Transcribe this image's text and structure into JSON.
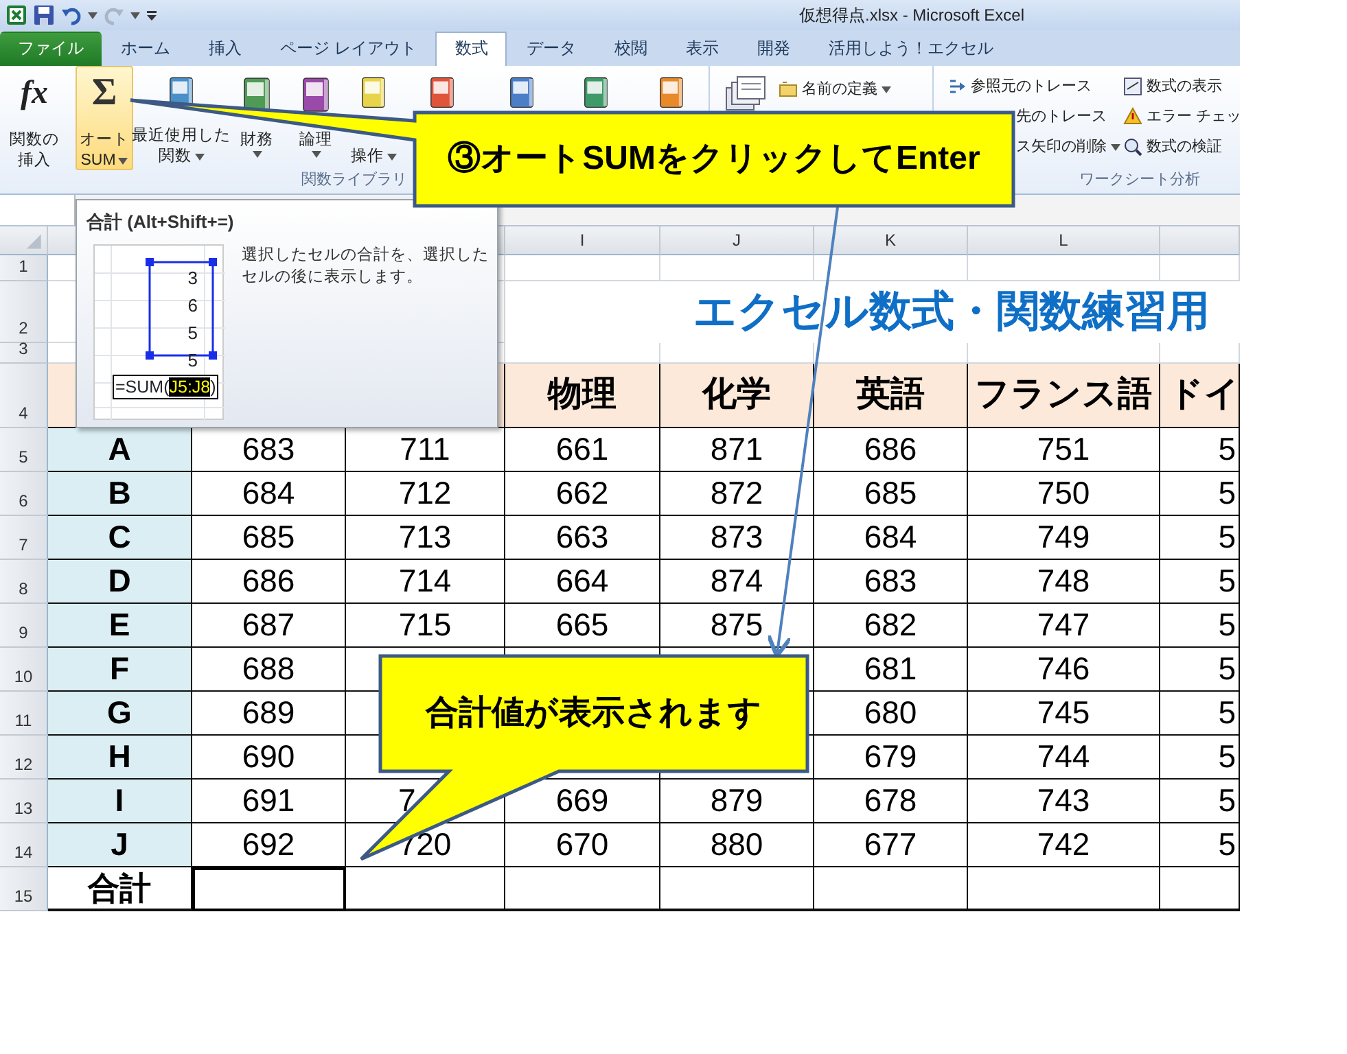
{
  "title_bar": {
    "title": "仮想得点.xlsx - Microsoft Excel"
  },
  "tabs": [
    {
      "label": "ファイル",
      "kind": "file",
      "selected": false
    },
    {
      "label": "ホーム",
      "kind": "tab",
      "selected": false
    },
    {
      "label": "挿入",
      "kind": "tab",
      "selected": false
    },
    {
      "label": "ページ レイアウト",
      "kind": "tab",
      "selected": false
    },
    {
      "label": "数式",
      "kind": "tab",
      "selected": true
    },
    {
      "label": "データ",
      "kind": "tab",
      "selected": false
    },
    {
      "label": "校閲",
      "kind": "tab",
      "selected": false
    },
    {
      "label": "表示",
      "kind": "tab",
      "selected": false
    },
    {
      "label": "開発",
      "kind": "tab",
      "selected": false
    },
    {
      "label": "活用しよう！エクセル",
      "kind": "tab",
      "selected": false
    }
  ],
  "ribbon": {
    "function_library": {
      "label": "関数ライブラリ",
      "buttons": [
        {
          "kind": "insert-function",
          "icon_text": "fx",
          "lines": [
            "関数の",
            "挿入"
          ],
          "dropdown": false,
          "hovered": false
        },
        {
          "kind": "autosum",
          "icon_text": "Σ",
          "lines": [
            "オート",
            "SUM"
          ],
          "dropdown": true,
          "hovered": true
        },
        {
          "kind": "library",
          "lines": [
            "最近使用した",
            "関数"
          ],
          "dropdown": true,
          "hovered": false
        },
        {
          "kind": "library",
          "lines": [
            "財務"
          ],
          "dropdown": true,
          "hovered": false
        },
        {
          "kind": "library",
          "lines": [
            "論理"
          ],
          "dropdown": true,
          "hovered": false
        },
        {
          "kind": "library-lower",
          "lines": [
            "操作"
          ],
          "dropdown": true,
          "hovered": false
        },
        {
          "kind": "library-icon-only",
          "hovered": false
        },
        {
          "kind": "library-icon-only",
          "hovered": false
        },
        {
          "kind": "library-icon-only",
          "hovered": false
        },
        {
          "kind": "library-icon-only",
          "hovered": false
        }
      ]
    },
    "defined_names": {
      "items": [
        {
          "label": "名前の定義",
          "dropdown": true
        }
      ]
    },
    "formula_auditing": {
      "label": "ワークシート分析",
      "columns": [
        {
          "items": [
            {
              "label": "参照元のトレース",
              "kind": "with-icon",
              "dropdown": false
            },
            {
              "label": "先のトレース",
              "kind": "text-only",
              "dropdown": false
            },
            {
              "label": "ス矢印の削除",
              "kind": "text-only",
              "dropdown": true
            }
          ]
        },
        {
          "items": [
            {
              "label": "数式の表示",
              "kind": "with-icon",
              "dropdown": false
            },
            {
              "label": "エラー チェッ",
              "kind": "with-icon",
              "dropdown": false
            },
            {
              "label": "数式の検証",
              "kind": "with-icon",
              "dropdown": false
            }
          ]
        }
      ]
    }
  },
  "tooltip": {
    "title": "合計 (Alt+Shift+=)",
    "description": "選択したセルの合計を、選択したセルの後に表示します。",
    "preview_values": [
      "3",
      "6",
      "5",
      "5"
    ],
    "formula_prefix": "=SUM(",
    "formula_range": "J5:J8",
    "formula_suffix": ")"
  },
  "sheet": {
    "columns": [
      {},
      {},
      {},
      {
        "header": "I"
      },
      {
        "header": "J"
      },
      {
        "header": "K"
      },
      {
        "header": "L"
      },
      {}
    ],
    "row_numbers": [
      "1",
      "2",
      "3",
      "4",
      "5",
      "6",
      "7",
      "8",
      "9",
      "10",
      "11",
      "12",
      "13",
      "14",
      "15"
    ],
    "title": "エクセル数式・関数練習用",
    "subject_headers": [
      "物理",
      "化学",
      "英語",
      "フランス語",
      "ドイ"
    ],
    "rows": [
      {
        "label": "A",
        "column_2": "683",
        "column_3": "711",
        "column_4": "661",
        "column_5": "871",
        "column_6": "686",
        "column_7": "751",
        "column_8": "5"
      },
      {
        "label": "B",
        "column_2": "684",
        "column_3": "712",
        "column_4": "662",
        "column_5": "872",
        "column_6": "685",
        "column_7": "750",
        "column_8": "5"
      },
      {
        "label": "C",
        "column_2": "685",
        "column_3": "713",
        "column_4": "663",
        "column_5": "873",
        "column_6": "684",
        "column_7": "749",
        "column_8": "5"
      },
      {
        "label": "D",
        "column_2": "686",
        "column_3": "714",
        "column_4": "664",
        "column_5": "874",
        "column_6": "683",
        "column_7": "748",
        "column_8": "5"
      },
      {
        "label": "E",
        "column_2": "687",
        "column_3": "715",
        "column_4": "665",
        "column_5": "875",
        "column_6": "682",
        "column_7": "747",
        "column_8": "5"
      },
      {
        "label": "F",
        "column_2": "688",
        "column_6": "681",
        "column_7": "746",
        "column_8": "5"
      },
      {
        "label": "G",
        "column_2": "689",
        "column_6": "680",
        "column_7": "745",
        "column_8": "5"
      },
      {
        "label": "H",
        "column_2": "690",
        "column_6": "679",
        "column_7": "744",
        "column_8": "5"
      },
      {
        "label": "I",
        "column_2": "691",
        "column_3": "7",
        "column_3_partial": true,
        "column_4": "669",
        "column_5": "879",
        "column_6": "678",
        "column_7": "743",
        "column_8": "5"
      },
      {
        "label": "J",
        "column_2": "692",
        "column_3": "720",
        "column_4": "670",
        "column_5": "880",
        "column_6": "677",
        "column_7": "742",
        "column_8": "5"
      }
    ],
    "total_row": {
      "label": "合計",
      "cells": [
        {
          "selected": true
        },
        {
          "selected": false
        },
        {
          "selected": false
        },
        {
          "selected": false
        },
        {
          "selected": false
        },
        {
          "selected": false
        },
        {
          "selected": false
        }
      ]
    }
  },
  "callouts": [
    {
      "text": "③オートSUMをクリックしてEnter",
      "kind": "top"
    },
    {
      "text": "合計値が表示されます",
      "kind": "bottom"
    }
  ]
}
